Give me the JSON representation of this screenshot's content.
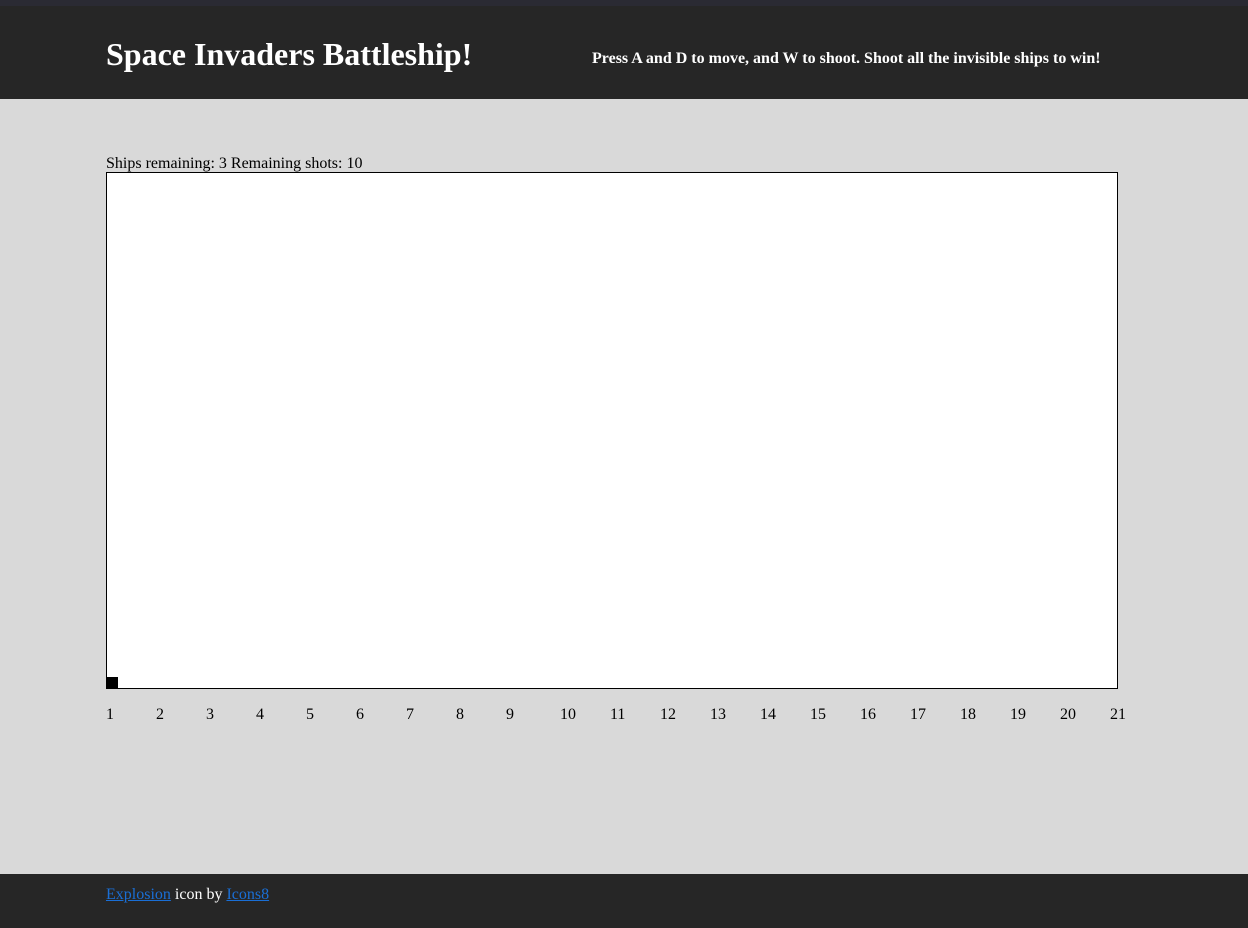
{
  "header": {
    "title": "Space Invaders Battleship!",
    "instructions": "Press A and D to move, and W to shoot. Shoot all the invisible ships to win!"
  },
  "status": {
    "ships_label": "Ships remaining:",
    "ships_remaining": "3",
    "shots_label": "Remaining shots:",
    "shots_remaining": "10"
  },
  "board": {
    "columns": [
      "1",
      "2",
      "3",
      "4",
      "5",
      "6",
      "7",
      "8",
      "9",
      "10",
      "11",
      "12",
      "13",
      "14",
      "15",
      "16",
      "17",
      "18",
      "19",
      "20",
      "21"
    ],
    "player_column": "1"
  },
  "footer": {
    "explosion_link": "Explosion",
    "icon_by_text": " icon by ",
    "icons8_link": "Icons8"
  },
  "colors": {
    "header_bg": "#262626",
    "page_bg": "#d9d9d9",
    "link": "#1a6fd6"
  }
}
